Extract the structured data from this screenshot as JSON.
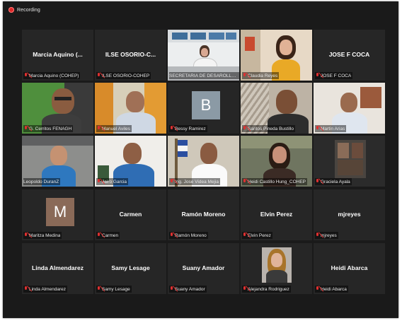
{
  "meeting": {
    "recording_label": "Recording"
  },
  "participants": [
    {
      "name": "Marcia Aquino (COHEP)",
      "center_label": "Marcia Aquino (...",
      "kind": "name"
    },
    {
      "name": "ILSE OSORIO-COHEP",
      "center_label": "ILSE OSORIO-C...",
      "kind": "name"
    },
    {
      "name": "SECRETARIA DE DESAROLLO E...",
      "kind": "video",
      "active_speaker": true
    },
    {
      "name": "Claudia Reyes",
      "kind": "video"
    },
    {
      "name": "JOSE F COCA",
      "center_label": "JOSE F COCA",
      "kind": "name"
    },
    {
      "name": "G. Cerritos FENAGH",
      "kind": "video"
    },
    {
      "name": "Manuel Aviles",
      "kind": "video"
    },
    {
      "name": "Bessy Ramirez",
      "kind": "avatar",
      "initial": "B"
    },
    {
      "name": "Santos Pineda Bustillo",
      "kind": "video"
    },
    {
      "name": "Martin Arias",
      "kind": "video"
    },
    {
      "name": "Leopoldo DuranZ",
      "kind": "video"
    },
    {
      "name": "Jairo Garcia",
      "kind": "video"
    },
    {
      "name": "Ing. Jose Videa Mejia",
      "kind": "video"
    },
    {
      "name": "Heidi Castillo Hung_COHEP",
      "kind": "video"
    },
    {
      "name": "Graciela Ayala",
      "kind": "video"
    },
    {
      "name": "Maritza Medina",
      "kind": "avatar",
      "initial": "M"
    },
    {
      "name": "Carmen",
      "center_label": "Carmen",
      "kind": "name"
    },
    {
      "name": "Ramón Moreno",
      "center_label": "Ramón Moreno",
      "kind": "name"
    },
    {
      "name": "Elvin Perez",
      "center_label": "Elvin Perez",
      "kind": "name"
    },
    {
      "name": "mjreyes",
      "center_label": "mjreyes",
      "kind": "name"
    },
    {
      "name": "Linda Almendarez",
      "center_label": "Linda Almendarez",
      "kind": "name"
    },
    {
      "name": "Samy  Lesage",
      "center_label": "Samy  Lesage",
      "kind": "name"
    },
    {
      "name": "Suany Amador",
      "center_label": "Suany Amador",
      "kind": "name"
    },
    {
      "name": "Alejandra Rodriguez",
      "kind": "photo"
    },
    {
      "name": "Heidi Abarca",
      "center_label": "Heidi Abarca",
      "kind": "name"
    }
  ],
  "colors": {
    "background": "#1a1a1a",
    "tile": "#262626",
    "active_border": "#d8e04a",
    "muted_mic": "#e03030"
  },
  "icons": {
    "recording": "red-dot-icon",
    "muted": "muted-mic-icon"
  }
}
